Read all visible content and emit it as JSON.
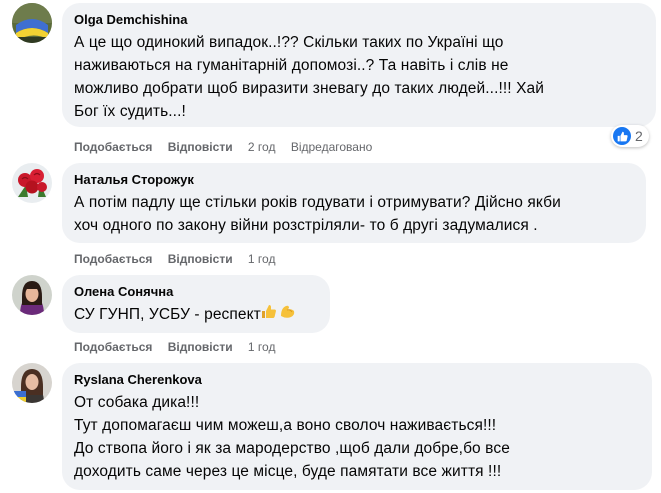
{
  "comments": [
    {
      "author": "Olga Demchishina",
      "lines": [
        "А це що одинокий випадок..!?? Скільки таких по Україні що",
        "наживаються на гуманітарній допомозі..? Та навіть і слів не",
        "можливо добрати щоб виразити зневагу до таких людей...!!! Хай",
        "Бог їх судить...!"
      ],
      "like_label": "Подобається",
      "reply_label": "Відповісти",
      "time": "2 год",
      "edited": "Відредаговано",
      "reaction_count": "2",
      "avatar_icon": "flag-profile-avatar"
    },
    {
      "author": "Наталья Сторожук",
      "lines": [
        "А потім падлу ще стільки років годувати і отримувати? Дійсно якби",
        "хоч одного по закону війни розстріляли- то б другі задумалися ."
      ],
      "like_label": "Подобається",
      "reply_label": "Відповісти",
      "time": "1 год",
      "avatar_icon": "roses-avatar"
    },
    {
      "author": "Олена Сонячна",
      "text": "СУ ГУНП, УСБУ - респект",
      "emojis": [
        "thumbs-up-icon",
        "flexed-biceps-icon"
      ],
      "like_label": "Подобається",
      "reply_label": "Відповісти",
      "time": "1 год",
      "avatar_icon": "woman-portrait-avatar"
    },
    {
      "author": "Ryslana Cherenkova",
      "lines": [
        "От собака дика!!!",
        "Тут допомагаєш чим можеш,а воно сволоч наживається!!!",
        "До ствопа його і як за мародерство ,щоб дали добре,бо все",
        "доходить саме через це місце, буде памятати все життя !!!"
      ],
      "avatar_icon": "woman-flag-avatar"
    }
  ],
  "colors": {
    "bubble": "#f0f2f5",
    "meta": "#65676b",
    "like_blue": "#1877f2"
  }
}
